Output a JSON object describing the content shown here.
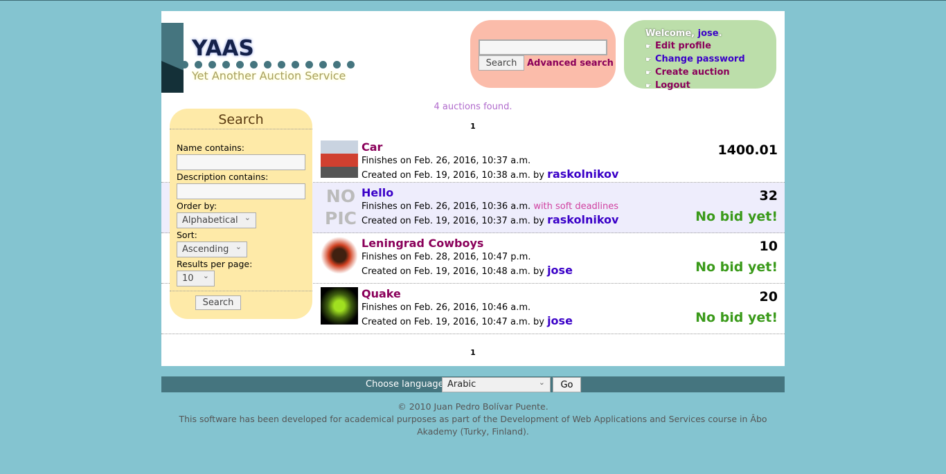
{
  "header": {
    "title": "YAAS",
    "subtitle": "Yet Another Auction Service"
  },
  "quick_search": {
    "value": "",
    "button": "Search",
    "advanced": "Advanced search"
  },
  "user": {
    "welcome": "Welcome,",
    "username": "jose",
    "links": [
      "Edit profile",
      "Change password",
      "Create auction",
      "Logout"
    ]
  },
  "results": {
    "found": "4 auctions found.",
    "page": "1",
    "items": [
      {
        "name": "Car",
        "finishes": "Finishes on Feb. 26, 2016, 10:37 a.m.",
        "soft": "",
        "created": "Created on Feb. 19, 2016, 10:38 a.m. by",
        "seller": "raskolnikov",
        "price": "1400.01",
        "status": ""
      },
      {
        "name": "Hello",
        "finishes": "Finishes on Feb. 26, 2016, 10:36 a.m.",
        "soft": "with soft deadlines",
        "created": "Created on Feb. 19, 2016, 10:37 a.m. by",
        "seller": "raskolnikov",
        "price": "32",
        "status": "No bid yet!",
        "nopic": "NO PIC"
      },
      {
        "name": "Leningrad Cowboys",
        "finishes": "Finishes on Feb. 28, 2016, 10:47 p.m.",
        "soft": "",
        "created": "Created on Feb. 19, 2016, 10:48 a.m. by",
        "seller": "jose",
        "price": "10",
        "status": "No bid yet!"
      },
      {
        "name": "Quake",
        "finishes": "Finishes on Feb. 26, 2016, 10:46 a.m.",
        "soft": "",
        "created": "Created on Feb. 19, 2016, 10:47 a.m. by",
        "seller": "jose",
        "price": "20",
        "status": "No bid yet!"
      }
    ]
  },
  "sidebar": {
    "title": "Search",
    "name_label": "Name contains:",
    "desc_label": "Description contains:",
    "order_label": "Order by:",
    "order_value": "Alphabetical",
    "sort_label": "Sort:",
    "sort_value": "Ascending",
    "per_page_label": "Results per page:",
    "per_page_value": "10",
    "button": "Search"
  },
  "footer": {
    "lang_label": "Choose language:",
    "lang_value": "Arabic",
    "go": "Go",
    "copyright": "© 2010 Juan Pedro Bolívar Puente.",
    "note": "This software has been developed for academical purposes as part of the Development of Web Applications and Services course in Âbo Akademy (Turky, Finland)."
  },
  "colors": {
    "background": "#84c4d0",
    "accent": "#45757f",
    "link": "#8a005a",
    "user": "#3a00c8",
    "nobid": "#3a9a1a"
  }
}
